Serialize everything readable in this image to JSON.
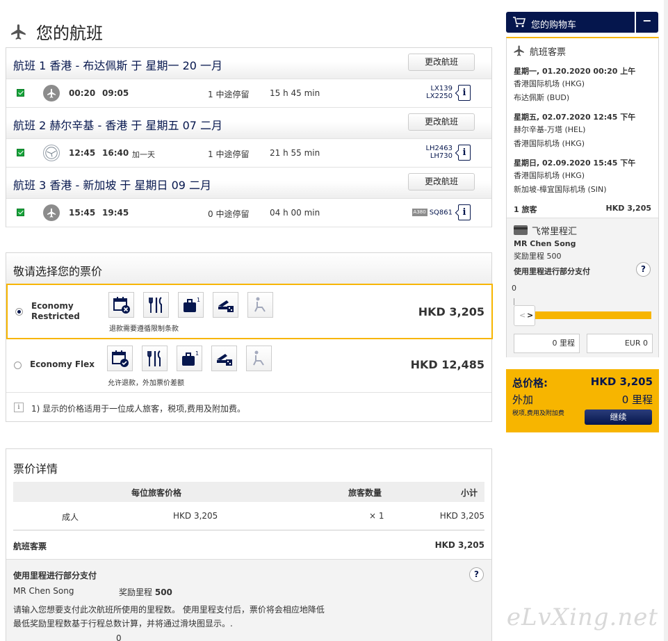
{
  "page": {
    "title": "您的航班"
  },
  "flights": [
    {
      "title_num": "航班 1",
      "route": "香港 - 布达佩斯",
      "date": "于 星期一 20 一月",
      "change": "更改航班",
      "dep": "00:20",
      "arr": "09:05",
      "plus": "",
      "stops": "1 中途停留",
      "duration": "15 h 45 min",
      "fn1": "LX139",
      "fn2": "LX2250",
      "airline": "airplane-icon"
    },
    {
      "title_num": "航班 2",
      "route": "赫尔辛基 - 香港",
      "date": "于 星期五 07 二月",
      "change": "更改航班",
      "dep": "12:45",
      "arr": "16:40",
      "plus": "加一天",
      "stops": "1 中途停留",
      "duration": "21 h 55 min",
      "fn1": "LH2463",
      "fn2": "LH730",
      "airline": "crane-logo-icon"
    },
    {
      "title_num": "航班 3",
      "route": "香港 - 新加坡",
      "date": "于 星期日 09 二月",
      "change": "更改航班",
      "dep": "15:45",
      "arr": "19:45",
      "plus": "",
      "stops": "0 中途停留",
      "duration": "04 h 00 min",
      "aircraft": "A380",
      "fn1": "SQ861",
      "airline": "airplane-icon"
    }
  ],
  "fares": {
    "heading": "敬请选择您的票价",
    "options": [
      {
        "name1": "Economy",
        "name2": "Restricted",
        "note": "退款需要遵循限制条款",
        "price": "HKD 3,205",
        "selected": true
      },
      {
        "name1": "Economy Flex",
        "name2": "",
        "note": "允许退款，外加票价差额",
        "price": "HKD 12,485",
        "selected": false
      }
    ],
    "bag_count": "1",
    "footnote": "1) 显示的价格适用于一位成人旅客，税项,费用及附加费。"
  },
  "details": {
    "heading": "票价详情",
    "col_price": "每位旅客价格",
    "col_qty": "旅客数量",
    "col_sub": "小计",
    "row_type": "成人",
    "row_price": "HKD 3,205",
    "row_qty": "× 1",
    "row_sub": "HKD 3,205",
    "total_label": "航班客票",
    "total_value": "HKD 3,205",
    "miles_title": "使用里程进行部分支付",
    "miles_name": "MR Chen Song",
    "miles_label": "奖励里程",
    "miles_value": "500",
    "miles_desc1": "请输入您想要支付此次航班所使用的里程数。 使用里程支付后，票价将会相应地降低",
    "miles_desc2": "最低奖励里程数基于行程总数计算，并将通过滑块图显示。.",
    "miles_zero": "0",
    "help": "?"
  },
  "cart": {
    "title": "您的购物车",
    "minimize": "−",
    "tickets_title": "航班客票",
    "legs": [
      {
        "dt": "星期一, 01.20.2020 00:20 上午",
        "from": "香港国际机场 (HKG)",
        "to": "布达佩斯 (BUD)"
      },
      {
        "dt": "星期五, 02.07.2020 12:45 下午",
        "from": "赫尔辛基-万塔 (HEL)",
        "to": "香港国际机场 (HKG)"
      },
      {
        "dt": "星期日, 02.09.2020 15:45 下午",
        "from": "香港国际机场 (HKG)",
        "to": "新加坡-樟宜国际机场 (SIN)"
      }
    ],
    "pax": "1 旅客",
    "pax_price": "HKD 3,205",
    "miles_program": "飞常里程汇",
    "member": "MR Chen Song",
    "award_miles": "奖励里程 500",
    "partial_pay": "使用里程进行部分支付",
    "help": "?",
    "slider_zero": "0",
    "slider_left": "<",
    "slider_right": ">",
    "miles_field": "0 里程",
    "eur_field": "EUR 0"
  },
  "totals": {
    "label": "总价格:",
    "value": "HKD 3,205",
    "extra_label": "外加",
    "extra_value": "0 里程",
    "tax_note": "税项,费用及附加费",
    "continue": "继续"
  },
  "watermark": "eLvXing.net",
  "colors": {
    "brand": "#05164d",
    "accent": "#f7b500",
    "check": "#17a43b"
  }
}
